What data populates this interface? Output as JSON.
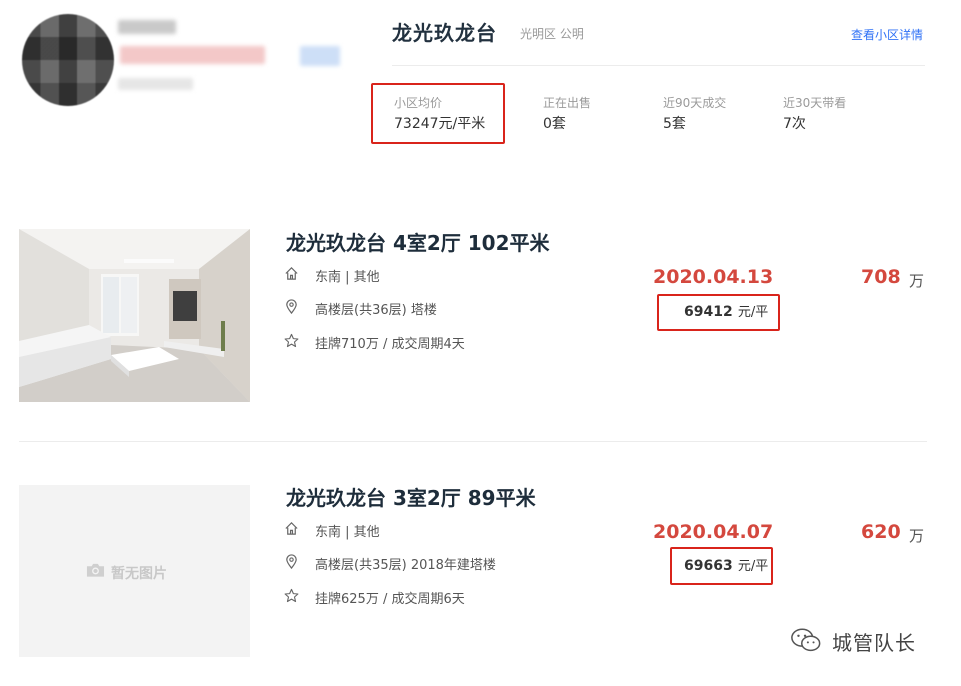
{
  "community": {
    "name": "龙光玖龙台",
    "district": "光明区 公明",
    "detail_link": "查看小区详情",
    "stats": [
      {
        "label": "小区均价",
        "value": "73247元/平米"
      },
      {
        "label": "正在出售",
        "value": "0套"
      },
      {
        "label": "近90天成交",
        "value": "5套"
      },
      {
        "label": "近30天带看",
        "value": "7次"
      }
    ]
  },
  "listings": [
    {
      "title": "龙光玖龙台 4室2厅 102平米",
      "orientation": "东南 | 其他",
      "floor": "高楼层(共36层) 塔楼",
      "listing_info": "挂牌710万 / 成交周期4天",
      "date": "2020.04.13",
      "price": "708",
      "price_unit": "万",
      "unit_price": "69412",
      "unit_price_suffix": "元/平",
      "image_placeholder": ""
    },
    {
      "title": "龙光玖龙台 3室2厅 89平米",
      "orientation": "东南 | 其他",
      "floor": "高楼层(共35层) 2018年建塔楼",
      "listing_info": "挂牌625万 / 成交周期6天",
      "date": "2020.04.07",
      "price": "620",
      "price_unit": "万",
      "unit_price": "69663",
      "unit_price_suffix": "元/平",
      "image_placeholder": "暂无图片"
    }
  ],
  "watermark": "城管队长",
  "icons": [
    "home-icon",
    "location-pin-icon",
    "star-icon",
    "camera-icon",
    "wechat-icon"
  ],
  "colors": {
    "accent_red": "#d4483e",
    "highlight_box": "#d9241b",
    "link_blue": "#3072f6"
  }
}
